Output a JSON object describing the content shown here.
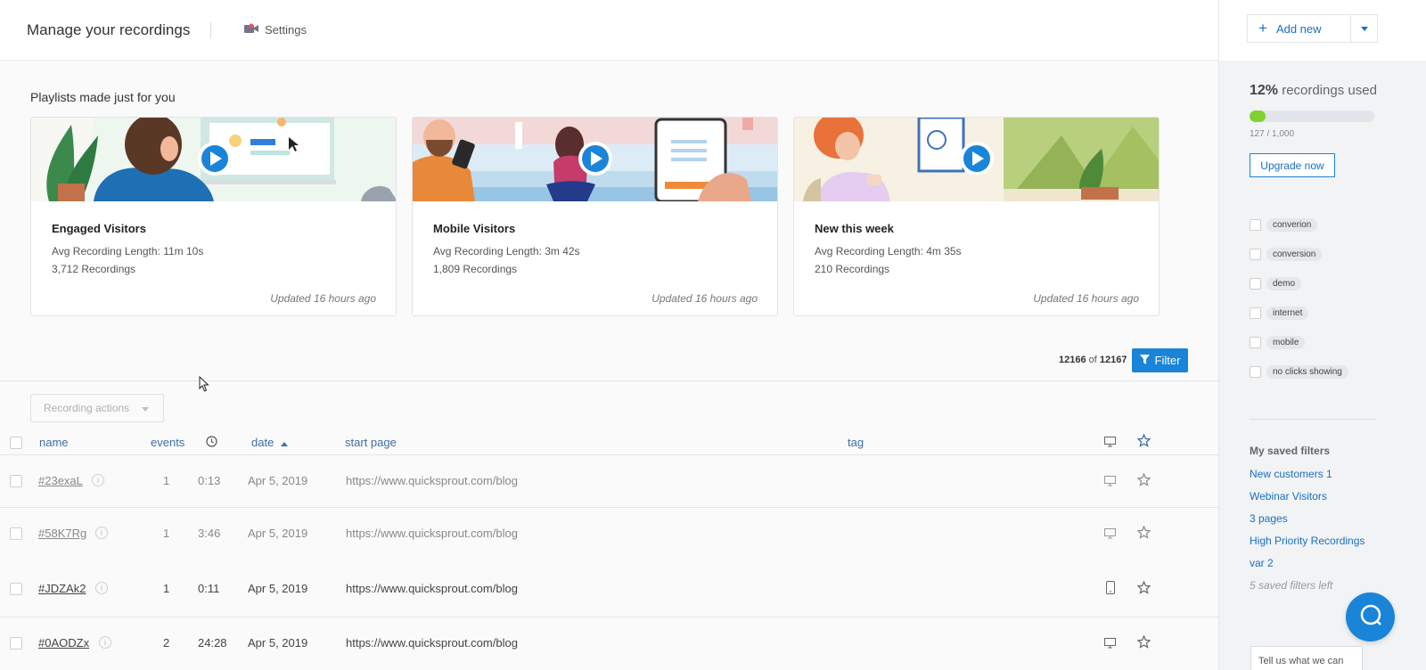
{
  "header": {
    "title": "Manage your recordings",
    "settings_label": "Settings"
  },
  "playlists": {
    "heading": "Playlists made just for you",
    "cards": [
      {
        "name": "Engaged Visitors",
        "avg": "Avg Recording Length: 11m 10s",
        "count": "3,712 Recordings",
        "updated": "Updated 16 hours ago"
      },
      {
        "name": "Mobile Visitors",
        "avg": "Avg Recording Length: 3m 42s",
        "count": "1,809 Recordings",
        "updated": "Updated 16 hours ago"
      },
      {
        "name": "New this week",
        "avg": "Avg Recording Length: 4m 35s",
        "count": "210 Recordings",
        "updated": "Updated 16 hours ago"
      }
    ]
  },
  "results": {
    "shown": "12166",
    "of_label": "of",
    "total": "12167",
    "filter_label": "Filter"
  },
  "actions": {
    "label": "Recording actions"
  },
  "table": {
    "columns": {
      "name": "name",
      "events": "events",
      "date": "date",
      "start_page": "start page",
      "tag": "tag"
    },
    "rows": [
      {
        "name": "#23exaL",
        "events": "1",
        "duration": "0:13",
        "date": "Apr 5, 2019",
        "start_page": "https://www.quicksprout.com/blog",
        "device": "desktop",
        "dim": true
      },
      {
        "name": "#58K7Rg",
        "events": "1",
        "duration": "3:46",
        "date": "Apr 5, 2019",
        "start_page": "https://www.quicksprout.com/blog",
        "device": "desktop",
        "dim": true
      },
      {
        "name": "#JDZAk2",
        "events": "1",
        "duration": "0:11",
        "date": "Apr 5, 2019",
        "start_page": "https://www.quicksprout.com/blog",
        "device": "mobile",
        "dim": false
      },
      {
        "name": "#0AODZx",
        "events": "2",
        "duration": "24:28",
        "date": "Apr 5, 2019",
        "start_page": "https://www.quicksprout.com/blog",
        "device": "desktop",
        "dim": false
      }
    ]
  },
  "sidebar": {
    "add_new_label": "Add new",
    "usage": {
      "percent": "12%",
      "label": "recordings used",
      "used": 127,
      "limit": 1000,
      "count_text": "127 / 1,000",
      "fraction": 0.127
    },
    "upgrade_label": "Upgrade now",
    "tags": [
      "converion",
      "conversion",
      "demo",
      "internet",
      "mobile",
      "no clicks showing"
    ],
    "saved_filters": {
      "heading": "My saved filters",
      "items": [
        "New customers 1",
        "Webinar Visitors",
        "3 pages",
        "High Priority Recordings",
        "var 2"
      ],
      "left_text": "5 saved filters left"
    },
    "feedback_text": "Tell us what we can"
  },
  "colors": {
    "accent": "#1a84d8",
    "link": "#1a6fc2",
    "usage_fill": "#7fd22e"
  }
}
